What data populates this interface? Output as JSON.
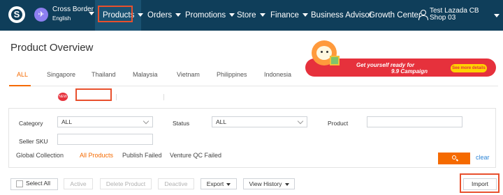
{
  "topnav": {
    "logo": "S",
    "plane": "✈",
    "account_title": "Cross Border",
    "account_lang": "English",
    "items": [
      {
        "label": "Products"
      },
      {
        "label": "Orders"
      },
      {
        "label": "Promotions"
      },
      {
        "label": "Store"
      },
      {
        "label": "Finance"
      },
      {
        "label": "Business Advisor"
      },
      {
        "label": "Growth Center"
      }
    ],
    "user": "Test Lazada CB Shop 03",
    "colors": {
      "bar": "#0f3e5a",
      "active": "#1a5272",
      "highlight": "#e8502d"
    }
  },
  "page": {
    "title": "Product Overview",
    "countries": [
      "ALL",
      "Singapore",
      "Thailand",
      "Malaysia",
      "Vietnam",
      "Philippines",
      "Indonesia"
    ],
    "active_country": "ALL",
    "subtabs": [
      "Global Collection",
      "All Products",
      "Publish Failed",
      "Venture QC Failed"
    ],
    "new_badge": "NEW",
    "accent": "#f56a00"
  },
  "banner": {
    "line1": "Get yourself ready for",
    "line2": "9.9 Campaign",
    "button": "See more details"
  },
  "filter": {
    "category_label": "Category",
    "category_value": "ALL",
    "status_label": "Status",
    "status_value": "ALL",
    "product_label": "Product",
    "product_value": "",
    "sku_label": "Seller SKU",
    "sku_value": "",
    "clear": "clear"
  },
  "actions": {
    "select_all": "Select All",
    "active": "Active",
    "delete": "Delete Product",
    "deactive": "Deactive",
    "export": "Export",
    "view_history": "View History",
    "import": "Import"
  }
}
